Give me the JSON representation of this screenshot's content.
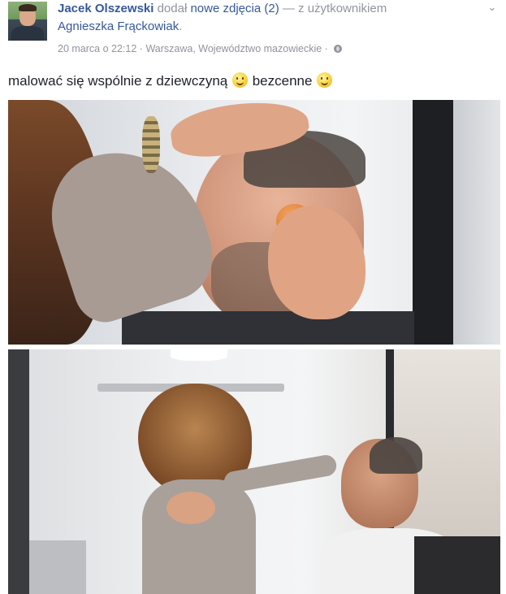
{
  "post": {
    "author": "Jacek Olszewski",
    "action": "dodał",
    "photos_link": "nowe zdjęcia (2)",
    "dash_with": " — z użytkownikiem",
    "tagged_user": "Agnieszka Frąckowiak",
    "tagged_suffix": ".",
    "date": "20 marca o 22:12",
    "separator": "·",
    "location": "Warszawa, Województwo mazowieckie",
    "separator2": "·",
    "privacy_icon": "globe-icon",
    "options_icon": "chevron-down-icon",
    "message_part1": "malować się wspólnie z dziewczyną",
    "message_part2": "bezcenne",
    "emoji": "smile-icon"
  },
  "photos": [
    {
      "description_icon": "photo-makeup-sponge"
    },
    {
      "description_icon": "photo-makeup-salon"
    }
  ]
}
